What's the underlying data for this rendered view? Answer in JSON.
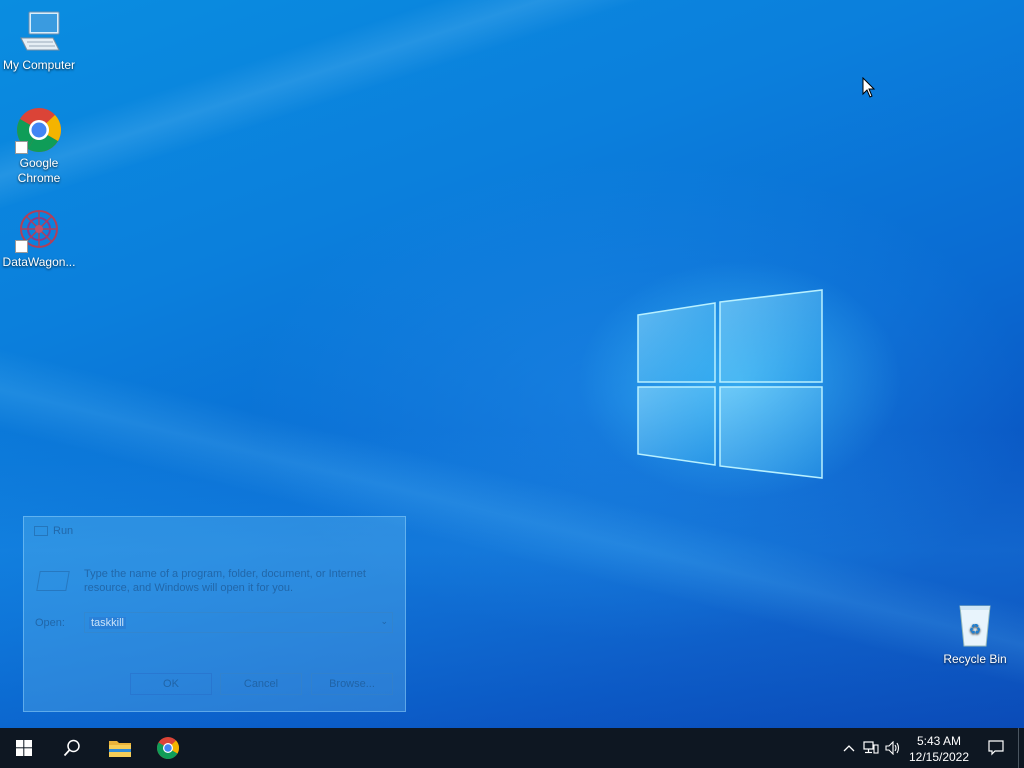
{
  "desktop": {
    "icons": [
      {
        "label": "My Computer",
        "icon": "computer-icon"
      },
      {
        "label": "Google Chrome",
        "icon": "chrome-icon"
      },
      {
        "label": "DataWagon...",
        "icon": "datawagon-icon"
      },
      {
        "label": "Recycle Bin",
        "icon": "recycle-bin-icon"
      }
    ]
  },
  "run_dialog": {
    "title": "Run",
    "description": "Type the name of a program, folder, document, or Internet resource, and Windows will open it for you.",
    "open_label": "Open:",
    "input_value": "taskkill",
    "ok_label": "OK",
    "cancel_label": "Cancel",
    "browse_label": "Browse..."
  },
  "taskbar": {
    "start_icon": "windows-start-icon",
    "search_icon": "search-icon",
    "pinned": [
      "file-explorer-icon",
      "chrome-icon"
    ],
    "tray": {
      "icons": [
        "chevron-up-icon",
        "network-icon",
        "volume-icon"
      ],
      "time": "5:43 AM",
      "date": "12/15/2022",
      "notification_icon": "notification-icon"
    }
  },
  "colors": {
    "taskbar": "#0e1722",
    "desktop_accent": "#0a7fdc"
  }
}
